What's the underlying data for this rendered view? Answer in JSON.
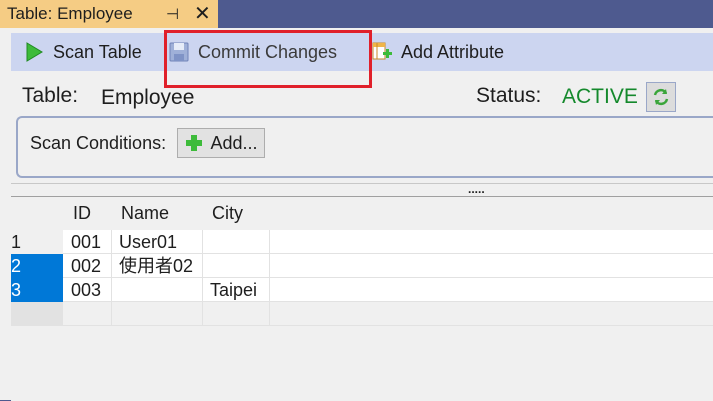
{
  "tab": {
    "title": "Table: Employee",
    "pin_icon": "pin-icon",
    "close_icon": "close-icon",
    "pin_glyph": "⊣",
    "close_glyph": "✕"
  },
  "toolbar": {
    "scan_label": "Scan Table",
    "commit_label": "Commit Changes",
    "add_attribute_label": "Add Attribute"
  },
  "table_info": {
    "table_label": "Table:",
    "table_name": "Employee",
    "status_label": "Status:",
    "status_value": "ACTIVE"
  },
  "scan_conditions": {
    "label": "Scan Conditions:",
    "add_label": "Add..."
  },
  "splitter": {
    "grip": "....."
  },
  "grid": {
    "columns": [
      "ID",
      "Name",
      "City"
    ],
    "rows": [
      {
        "num": "1",
        "id": "001",
        "name": "User01",
        "city": "",
        "selected": false
      },
      {
        "num": "2",
        "id": "002",
        "name": "使用者02",
        "city": "",
        "selected": true
      },
      {
        "num": "3",
        "id": "003",
        "name": "",
        "city": "Taipei",
        "selected": true
      }
    ]
  },
  "colors": {
    "accent_tab": "#f5cc84",
    "status_active": "#14892c",
    "selection": "#0078d7",
    "highlight_box": "#e0202a"
  }
}
